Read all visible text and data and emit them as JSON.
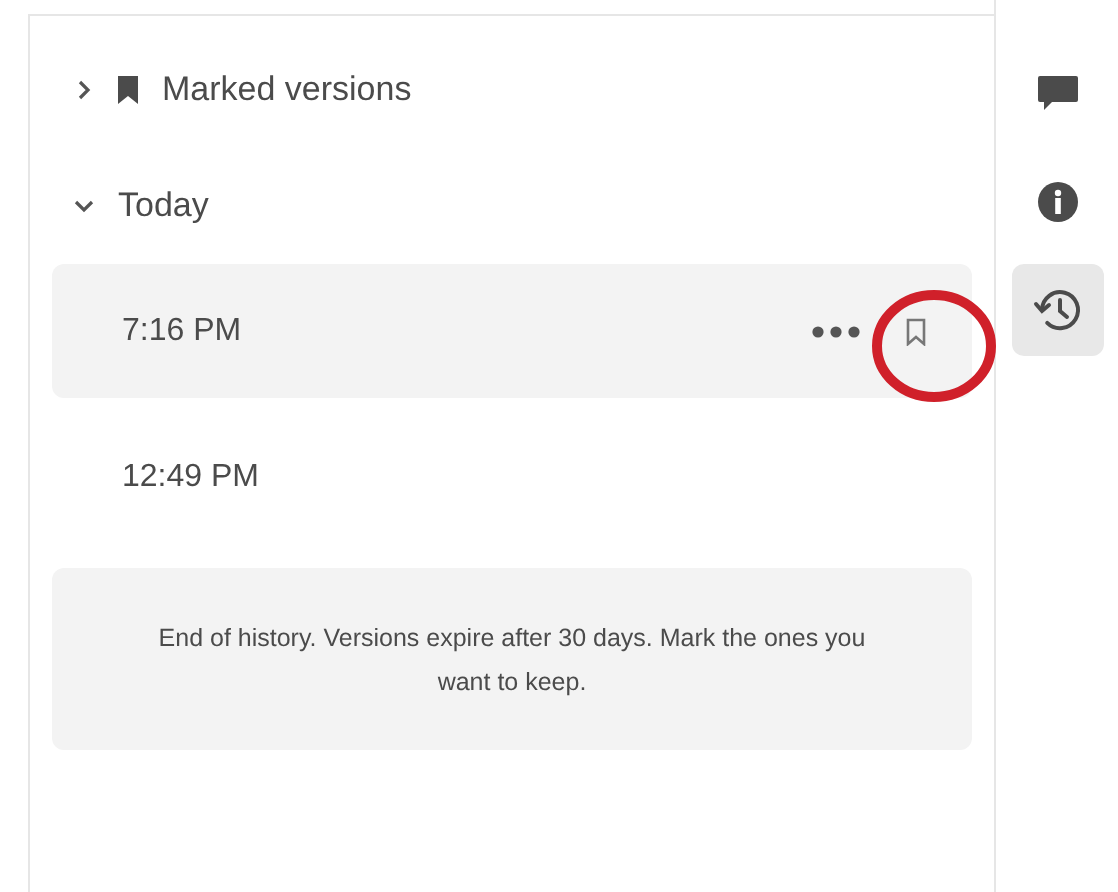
{
  "sections": [
    {
      "title": "Marked versions",
      "kind": "marked",
      "expanded": false
    },
    {
      "title": "Today",
      "kind": "plain",
      "expanded": true,
      "versions": [
        {
          "time": "7:16 PM",
          "selected": true,
          "annotated": true
        },
        {
          "time": "12:49 PM",
          "selected": false,
          "annotated": false
        }
      ]
    }
  ],
  "end_note": "End of history. Versions expire after 30 days. Mark the ones you want to keep.",
  "rail": [
    {
      "kind": "comment",
      "selected": false
    },
    {
      "kind": "info",
      "selected": false
    },
    {
      "kind": "history",
      "selected": true
    }
  ]
}
